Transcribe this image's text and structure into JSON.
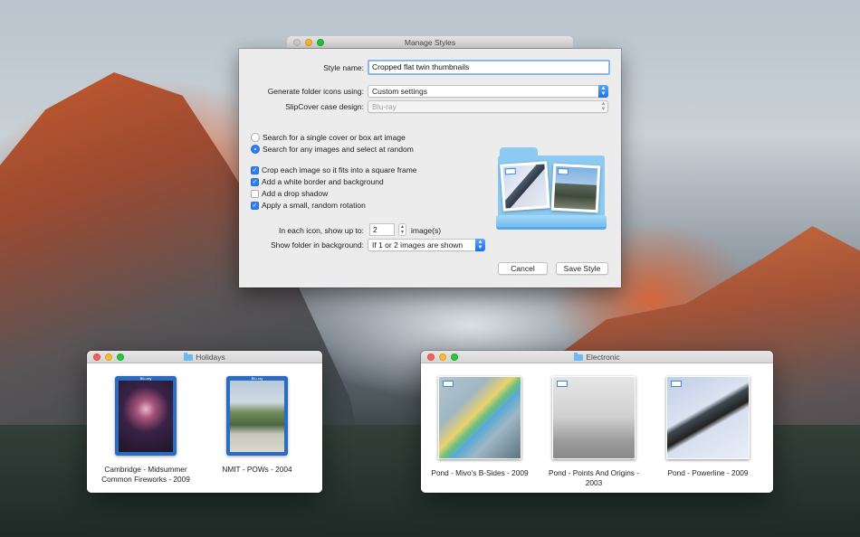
{
  "manage_styles": {
    "title": "Manage Styles",
    "style_name_label": "Style name:",
    "style_name_value": "Cropped flat twin thumbnails",
    "generate_label": "Generate folder icons using:",
    "generate_value": "Custom settings",
    "case_label": "SlipCover case design:",
    "case_value": "Blu-ray",
    "radio_single": "Search for a single cover or box art image",
    "radio_random": "Search for any images and select at random",
    "selected_radio": "random",
    "options": [
      {
        "label": "Crop each image so it fits into a square frame",
        "checked": true
      },
      {
        "label": "Add a white border and background",
        "checked": true
      },
      {
        "label": "Add a drop shadow",
        "checked": false
      },
      {
        "label": "Apply a small, random rotation",
        "checked": true
      }
    ],
    "show_up_to_label": "In each icon, show up to:",
    "show_up_to_value": "2",
    "show_up_to_unit": "image(s)",
    "folder_bg_label": "Show folder in background:",
    "folder_bg_value": "If 1 or 2 images are shown",
    "cancel_label": "Cancel",
    "save_label": "Save Style",
    "accent_color": "#2e7cf6"
  },
  "holidays": {
    "title": "Holidays",
    "items": [
      {
        "label": "Cambridge - Midsummer Common Fireworks - 2009",
        "icon": "blu-ray-case"
      },
      {
        "label": "NMIT - POWs - 2004",
        "icon": "blu-ray-case"
      }
    ]
  },
  "electronic": {
    "title": "Electronic",
    "items": [
      {
        "label": "Pond - Mivo's B-Sides - 2009",
        "icon": "album-cover"
      },
      {
        "label": "Pond - Points And Origins - 2003",
        "icon": "album-cover"
      },
      {
        "label": "Pond - Powerline - 2009",
        "icon": "album-cover"
      }
    ]
  }
}
